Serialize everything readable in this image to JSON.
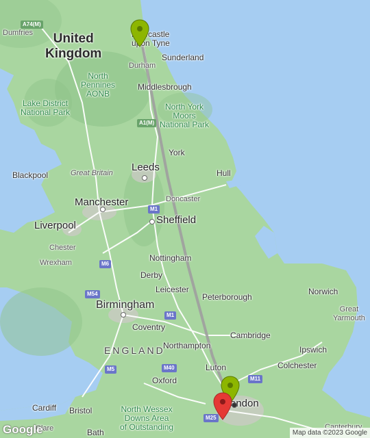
{
  "map": {
    "labels": {
      "uk": "United\nKingdom",
      "england": "ENGLAND",
      "newcastle": "Newcastle\nupon Tyne",
      "sunderland": "Sunderland",
      "durham": "Durham",
      "middlesbrough": "Middlesbrough",
      "york": "York",
      "leeds": "Leeds",
      "hull": "Hull",
      "doncaster": "Doncaster",
      "sheffield": "Sheffield",
      "manchester": "Manchester",
      "liverpool": "Liverpool",
      "blackpool": "Blackpool",
      "great_britain": "Great Britain",
      "chester": "Chester",
      "wrexham": "Wrexham",
      "nottingham": "Nottingham",
      "derby": "Derby",
      "leicester": "Leicester",
      "peterborough": "Peterborough",
      "norwich": "Norwich",
      "great_yarmouth": "Great\nYarmouth",
      "birmingham": "Birmingham",
      "coventry": "Coventry",
      "northampton": "Northampton",
      "cambridge": "Cambridge",
      "ipswich": "Ipswich",
      "luton": "Luton",
      "colchester": "Colchester",
      "oxford": "Oxford",
      "london": "ondon",
      "cardiff": "Cardiff",
      "bristol": "Bristol",
      "bath": "Bath",
      "canterbury": "Canterbury",
      "dumfries": "Dumfries",
      "lake_district": "Lake District\nNational Park",
      "north_pennines": "North\nPennines\nAONB",
      "north_york_moors": "North York\nMoors\nNational Park",
      "north_wessex": "North Wessex\nDowns Area\nof Outstanding",
      "clare": "Clare"
    },
    "road_shields": {
      "a74m": "A74(M)",
      "a1m": "A1(M)",
      "m1_north": "M1",
      "m1_south": "M1",
      "m6": "M6",
      "m54": "M54",
      "m5": "M5",
      "m40": "M40",
      "m11": "M11",
      "m25": "M25"
    },
    "markers": {
      "origin": "Newcastle upon Tyne",
      "waypoint": "Luton",
      "destination": "London"
    },
    "colors": {
      "water": "#a6cdf2",
      "land": "#a9d6a0",
      "route": "#9e9e9e",
      "pin_green": "#8db600",
      "pin_red": "#e53935"
    },
    "logo": "Google",
    "attribution": "Map data ©2023 Google"
  }
}
